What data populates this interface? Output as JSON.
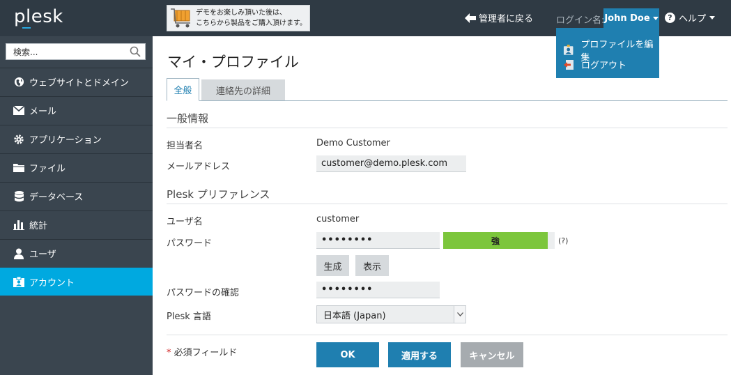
{
  "topbar": {
    "logo": "plesk",
    "promo_line1": "デモをお楽しみ頂いた後は、",
    "promo_line2": "こちらから製品をご購入頂けます。",
    "back_label": "管理者に戻る",
    "login_label": "ログイン名:",
    "user_name": "John Doe",
    "help_label": "ヘルプ"
  },
  "user_menu": {
    "items": [
      {
        "label": "プロファイルを編集",
        "icon": "profile-edit-icon"
      },
      {
        "label": "ログアウト",
        "icon": "logout-icon"
      }
    ]
  },
  "sidebar": {
    "search_placeholder": "検索...",
    "items": [
      {
        "label": "ウェブサイトとドメイン",
        "icon": "globe-icon"
      },
      {
        "label": "メール",
        "icon": "mail-icon"
      },
      {
        "label": "アプリケーション",
        "icon": "gear-icon"
      },
      {
        "label": "ファイル",
        "icon": "folder-icon"
      },
      {
        "label": "データベース",
        "icon": "database-icon"
      },
      {
        "label": "統計",
        "icon": "bar-chart-icon"
      },
      {
        "label": "ユーザ",
        "icon": "user-icon"
      },
      {
        "label": "アカウント",
        "icon": "account-icon",
        "active": true
      }
    ]
  },
  "main": {
    "title": "マイ・プロファイル",
    "tabs": [
      {
        "label": "全般",
        "active": true
      },
      {
        "label": "連絡先の詳細",
        "active": false
      }
    ],
    "general": {
      "header": "一般情報",
      "contact_name_label": "担当者名",
      "contact_name_value": "Demo Customer",
      "email_label": "メールアドレス",
      "email_value": "customer@demo.plesk.com"
    },
    "preferences": {
      "header": "Plesk プリファレンス",
      "username_label": "ユーザ名",
      "username_value": "customer",
      "password_label": "パスワード",
      "password_value": "••••••••",
      "strength_label": "強",
      "strength_help": "(?)",
      "generate_label": "生成",
      "show_label": "表示",
      "confirm_label": "パスワードの確認",
      "confirm_value": "••••••••",
      "language_label": "Plesk 言語",
      "language_value": "日本語 (Japan)"
    },
    "required_star": "*",
    "required_note": "必須フィールド",
    "buttons": {
      "ok": "OK",
      "apply": "適用する",
      "cancel": "キャンセル"
    }
  },
  "colors": {
    "topbar": "#2f3a44",
    "sidebar": "#3a454f",
    "active_nav": "#00a9e0",
    "primary_button": "#1f7fb0",
    "cancel_button": "#a6abaf",
    "strength_good": "#7cc63c"
  }
}
